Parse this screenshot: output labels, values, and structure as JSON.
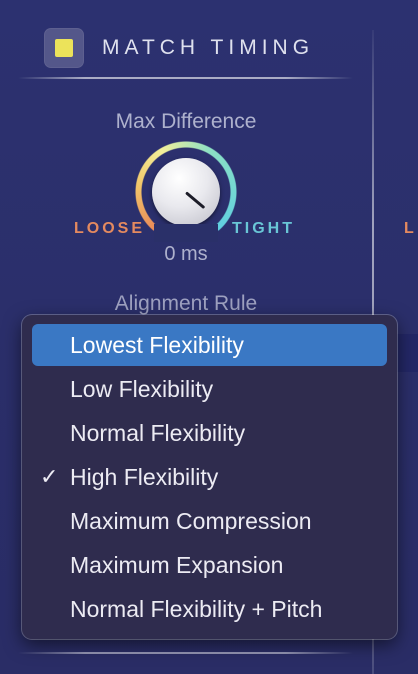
{
  "header": {
    "title": "MATCH TIMING",
    "toggle_on": true,
    "toggle_color": "#ece35a"
  },
  "max_difference": {
    "label": "Max Difference",
    "min_label": "LOOSE",
    "max_label": "TIGHT",
    "value": "0 ms"
  },
  "alignment_rule": {
    "label": "Alignment Rule"
  },
  "right_panel": {
    "letter": "L"
  },
  "menu": {
    "items": [
      {
        "label": "Lowest Flexibility",
        "highlighted": true,
        "checked": false
      },
      {
        "label": "Low Flexibility",
        "highlighted": false,
        "checked": false
      },
      {
        "label": "Normal Flexibility",
        "highlighted": false,
        "checked": false
      },
      {
        "label": "High Flexibility",
        "highlighted": false,
        "checked": true
      },
      {
        "label": "Maximum Compression",
        "highlighted": false,
        "checked": false
      },
      {
        "label": "Maximum Expansion",
        "highlighted": false,
        "checked": false
      },
      {
        "label": "Normal Flexibility + Pitch",
        "highlighted": false,
        "checked": false
      }
    ],
    "check_glyph": "✓"
  },
  "colors": {
    "accent_selected": "#3a78c4",
    "loose": "#e48a5f",
    "tight": "#69c6d6"
  }
}
